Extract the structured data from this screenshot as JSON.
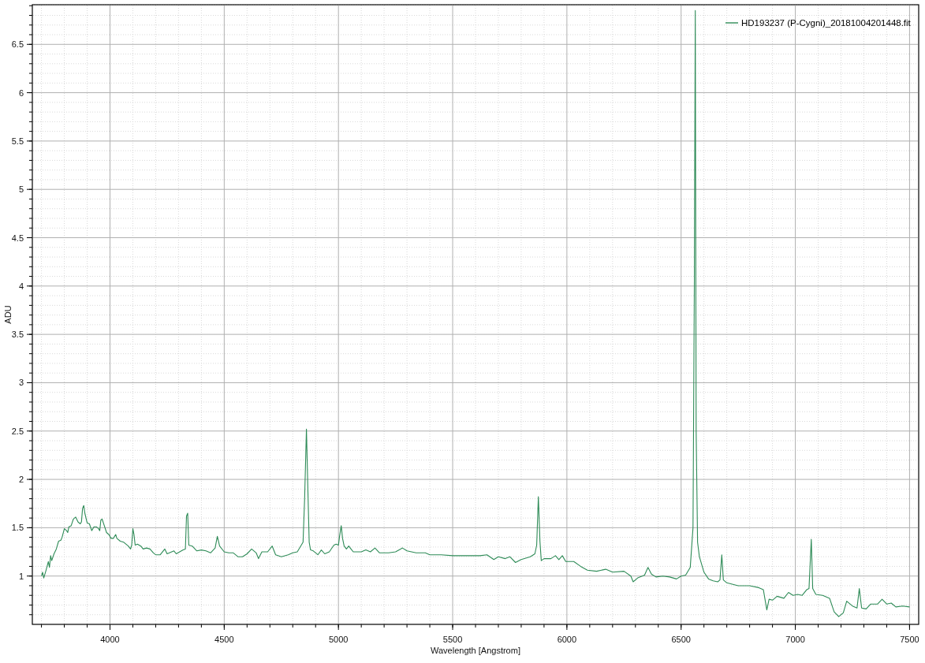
{
  "chart": {
    "chart_data": {
      "type": "line",
      "xlabel": "Wavelength [Angstrom]",
      "ylabel": "ADU",
      "grid": true,
      "x": [
        3700,
        3705,
        3710,
        3720,
        3730,
        3735,
        3740,
        3745,
        3755,
        3765,
        3775,
        3785,
        3790,
        3800,
        3810,
        3815,
        3820,
        3830,
        3840,
        3850,
        3860,
        3870,
        3875,
        3880,
        3885,
        3890,
        3900,
        3910,
        3920,
        3930,
        3940,
        3950,
        3955,
        3960,
        3965,
        3975,
        3985,
        3995,
        4005,
        4015,
        4025,
        4030,
        4045,
        4060,
        4080,
        4090,
        4095,
        4100,
        4105,
        4110,
        4120,
        4135,
        4145,
        4160,
        4175,
        4190,
        4200,
        4220,
        4240,
        4250,
        4280,
        4290,
        4320,
        4330,
        4335,
        4340,
        4345,
        4360,
        4380,
        4400,
        4420,
        4440,
        4460,
        4470,
        4480,
        4500,
        4520,
        4540,
        4560,
        4580,
        4600,
        4620,
        4640,
        4650,
        4665,
        4690,
        4710,
        4725,
        4750,
        4780,
        4800,
        4820,
        4845,
        4852,
        4860,
        4866,
        4872,
        4878,
        4890,
        4910,
        4925,
        4940,
        4960,
        4980,
        4990,
        5000,
        5005,
        5012,
        5018,
        5025,
        5035,
        5045,
        5055,
        5065,
        5100,
        5120,
        5140,
        5160,
        5180,
        5220,
        5250,
        5280,
        5300,
        5340,
        5380,
        5400,
        5450,
        5500,
        5550,
        5580,
        5620,
        5650,
        5680,
        5700,
        5730,
        5750,
        5775,
        5800,
        5840,
        5860,
        5868,
        5875,
        5882,
        5888,
        5900,
        5930,
        5950,
        5965,
        5980,
        5995,
        6010,
        6030,
        6060,
        6090,
        6130,
        6170,
        6200,
        6250,
        6280,
        6290,
        6310,
        6340,
        6355,
        6370,
        6390,
        6420,
        6450,
        6480,
        6500,
        6520,
        6540,
        6552,
        6558,
        6562,
        6566,
        6572,
        6580,
        6600,
        6620,
        6640,
        6660,
        6670,
        6678,
        6685,
        6700,
        6750,
        6800,
        6840,
        6860,
        6875,
        6885,
        6900,
        6920,
        6950,
        6970,
        6990,
        7010,
        7030,
        7050,
        7060,
        7070,
        7076,
        7090,
        7120,
        7150,
        7170,
        7190,
        7210,
        7225,
        7250,
        7270,
        7280,
        7290,
        7310,
        7330,
        7360,
        7380,
        7400,
        7420,
        7440,
        7470,
        7500
      ],
      "series": [
        {
          "name": "HD193237 (P-Cygni)_20181004201448.fit",
          "color": "#2e8b57",
          "values": [
            1.0,
            1.04,
            0.98,
            1.06,
            1.15,
            1.09,
            1.21,
            1.16,
            1.23,
            1.28,
            1.36,
            1.37,
            1.4,
            1.49,
            1.47,
            1.45,
            1.51,
            1.52,
            1.59,
            1.61,
            1.56,
            1.54,
            1.56,
            1.7,
            1.73,
            1.65,
            1.55,
            1.54,
            1.47,
            1.51,
            1.51,
            1.49,
            1.47,
            1.58,
            1.59,
            1.52,
            1.45,
            1.43,
            1.39,
            1.39,
            1.43,
            1.39,
            1.36,
            1.35,
            1.31,
            1.28,
            1.32,
            1.49,
            1.43,
            1.32,
            1.33,
            1.31,
            1.28,
            1.29,
            1.28,
            1.24,
            1.22,
            1.22,
            1.28,
            1.23,
            1.26,
            1.23,
            1.27,
            1.28,
            1.62,
            1.65,
            1.32,
            1.31,
            1.26,
            1.27,
            1.26,
            1.24,
            1.29,
            1.41,
            1.31,
            1.25,
            1.24,
            1.24,
            1.2,
            1.2,
            1.23,
            1.28,
            1.24,
            1.18,
            1.25,
            1.25,
            1.31,
            1.22,
            1.2,
            1.22,
            1.24,
            1.25,
            1.35,
            1.8,
            2.52,
            1.9,
            1.35,
            1.27,
            1.26,
            1.22,
            1.27,
            1.23,
            1.25,
            1.32,
            1.33,
            1.32,
            1.41,
            1.52,
            1.39,
            1.31,
            1.28,
            1.31,
            1.28,
            1.25,
            1.25,
            1.27,
            1.25,
            1.29,
            1.24,
            1.24,
            1.25,
            1.29,
            1.26,
            1.24,
            1.24,
            1.22,
            1.22,
            1.21,
            1.21,
            1.21,
            1.21,
            1.22,
            1.17,
            1.2,
            1.18,
            1.2,
            1.14,
            1.17,
            1.2,
            1.23,
            1.32,
            1.82,
            1.36,
            1.16,
            1.18,
            1.18,
            1.21,
            1.17,
            1.21,
            1.15,
            1.15,
            1.15,
            1.1,
            1.06,
            1.05,
            1.07,
            1.04,
            1.05,
            1.0,
            0.94,
            0.98,
            1.01,
            1.09,
            1.02,
            0.99,
            1.0,
            0.99,
            0.97,
            1.0,
            1.01,
            1.09,
            1.5,
            4.0,
            6.85,
            2.5,
            1.35,
            1.2,
            1.04,
            0.97,
            0.95,
            0.94,
            0.96,
            1.22,
            0.96,
            0.93,
            0.9,
            0.9,
            0.88,
            0.86,
            0.65,
            0.76,
            0.75,
            0.79,
            0.77,
            0.83,
            0.8,
            0.81,
            0.8,
            0.86,
            0.87,
            1.38,
            0.87,
            0.81,
            0.8,
            0.77,
            0.63,
            0.58,
            0.62,
            0.74,
            0.69,
            0.67,
            0.87,
            0.67,
            0.66,
            0.71,
            0.71,
            0.76,
            0.71,
            0.72,
            0.68,
            0.69,
            0.68
          ]
        }
      ],
      "xlim": [
        3660,
        7540
      ],
      "ylim": [
        0.5,
        6.91
      ],
      "xticks": [
        4000,
        4500,
        5000,
        5500,
        6000,
        6500,
        7000,
        7500
      ],
      "yticks": [
        1,
        1.5,
        2,
        2.5,
        3,
        3.5,
        4,
        4.5,
        5,
        5.5,
        6,
        6.5
      ]
    }
  }
}
